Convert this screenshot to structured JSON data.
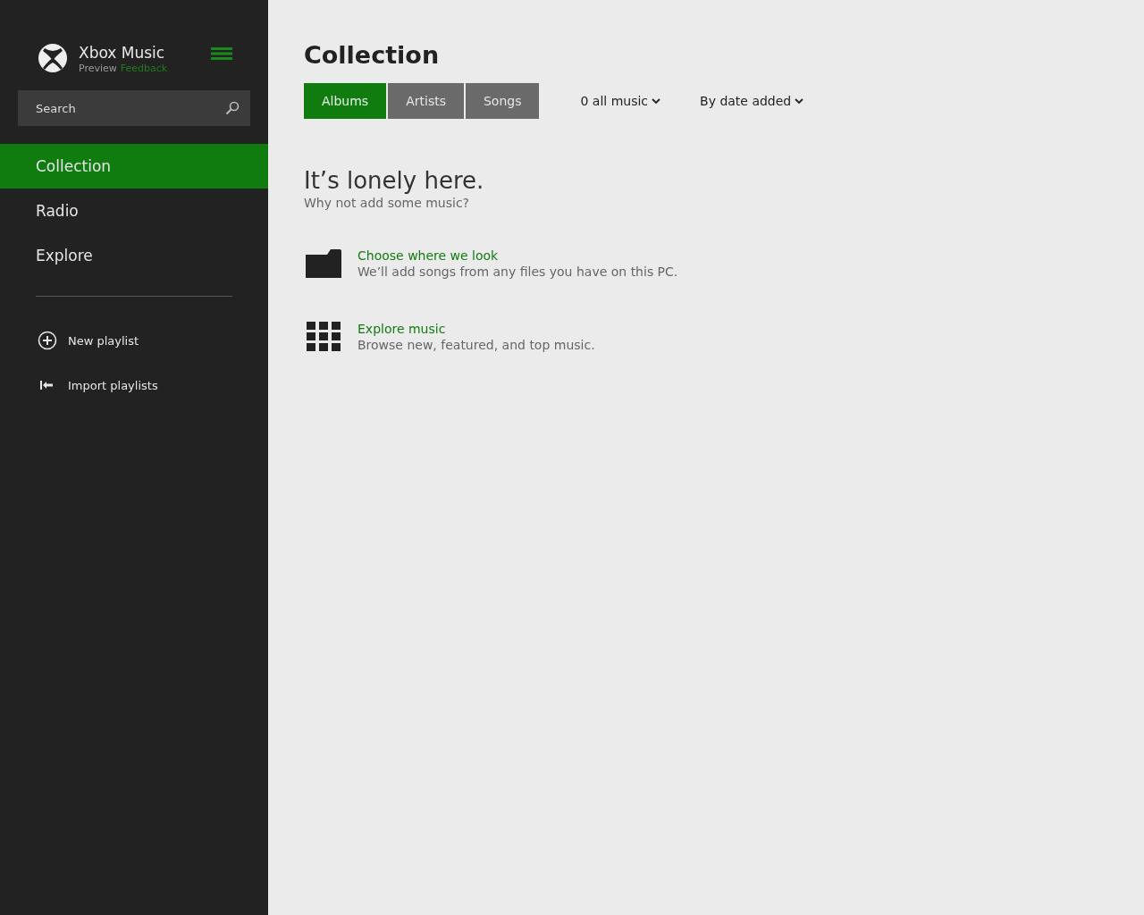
{
  "app": {
    "title": "Xbox Music",
    "tag": "Preview",
    "feedback": "Feedback"
  },
  "search": {
    "placeholder": "Search"
  },
  "nav": [
    {
      "label": "Collection",
      "selected": true
    },
    {
      "label": "Radio",
      "selected": false
    },
    {
      "label": "Explore",
      "selected": false
    }
  ],
  "actions": [
    {
      "kind": "add",
      "label": "New playlist"
    },
    {
      "kind": "import",
      "label": "Import playlists"
    }
  ],
  "page": {
    "title": "Collection"
  },
  "tabs": [
    {
      "label": "Albums",
      "selected": true
    },
    {
      "label": "Artists",
      "selected": false
    },
    {
      "label": "Songs",
      "selected": false
    }
  ],
  "filters": [
    {
      "label": "0 all music"
    },
    {
      "label": "By date added"
    }
  ],
  "empty": {
    "heading": "It’s lonely here.",
    "text": "Why not add some music?"
  },
  "suggestions": [
    {
      "kind": "folder",
      "title": "Choose where we look",
      "description": "We’ll add songs from any files you have on this PC."
    },
    {
      "kind": "grid",
      "title": "Explore music",
      "description": "Browse new, featured, and top music."
    }
  ]
}
